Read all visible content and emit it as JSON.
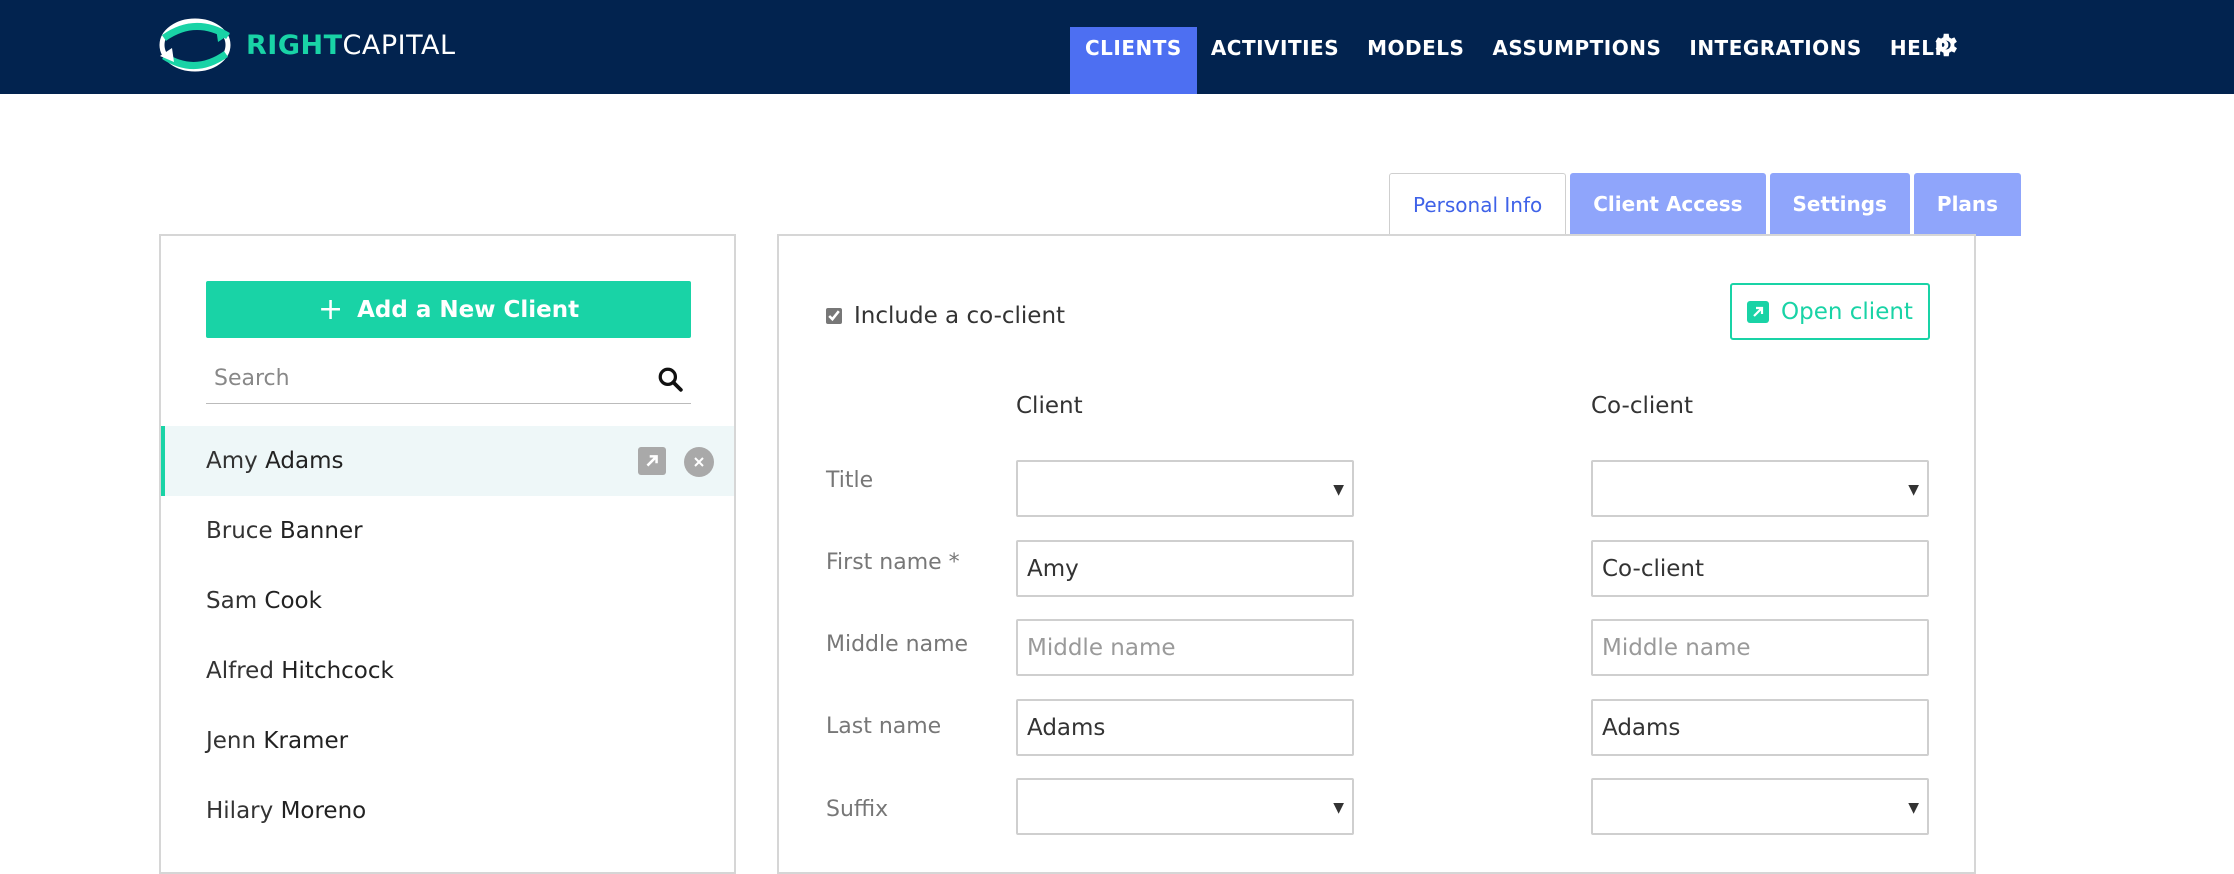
{
  "brand": {
    "part1": "RIGHT",
    "part2": "CAPITAL"
  },
  "nav": {
    "items": [
      "CLIENTS",
      "ACTIVITIES",
      "MODELS",
      "ASSUMPTIONS",
      "INTEGRATIONS",
      "HELP"
    ],
    "active": "CLIENTS"
  },
  "tabs": [
    "Personal Info",
    "Client Access",
    "Settings",
    "Plans"
  ],
  "sidebar": {
    "add_label": "Add a New Client",
    "search_placeholder": "Search",
    "clients": [
      {
        "first": "Amy",
        "last": "Adams"
      },
      {
        "first": "Bruce",
        "last": "Banner"
      },
      {
        "first": "Sam",
        "last": "Cook"
      },
      {
        "first": "Alfred",
        "last": "Hitchcock"
      },
      {
        "first": "Jenn",
        "last": "Kramer"
      },
      {
        "first": "Hilary",
        "last": "Moreno"
      }
    ]
  },
  "form": {
    "include_coclient_label": "Include a co-client",
    "include_coclient_checked": true,
    "open_client_label": "Open client",
    "client_header": "Client",
    "coclient_header": "Co-client",
    "labels": {
      "title": "Title",
      "first_name": "First name *",
      "middle_name": "Middle name",
      "last_name": "Last name",
      "suffix": "Suffix"
    },
    "client": {
      "first_name": "Amy",
      "middle_placeholder": "Middle name",
      "last_name": "Adams"
    },
    "coclient": {
      "first_name": "Co-client",
      "middle_placeholder": "Middle name",
      "last_name": "Adams"
    }
  },
  "colors": {
    "navbar": "#02234f",
    "accent": "#19d3a6",
    "active_nav": "#4d6ff2",
    "inactive_tab": "#8fa5fb"
  }
}
